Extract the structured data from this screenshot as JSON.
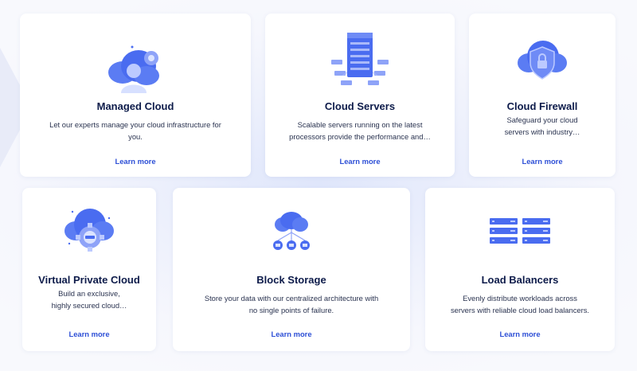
{
  "cards": [
    {
      "title": "Managed Cloud",
      "desc_line1": "Let our experts manage your cloud infrastructure for",
      "desc_line2": "you.",
      "link": "Learn more",
      "icon": "cloud-user-icon"
    },
    {
      "title": "Cloud Servers",
      "desc_line1": "Scalable servers running on the latest",
      "desc_line2": "processors provide the performance and…",
      "link": "Learn more",
      "icon": "server-rack-icon"
    },
    {
      "title": "Cloud Firewall",
      "desc_line1": "Safeguard your cloud",
      "desc_line2": "servers with industry…",
      "link": "Learn more",
      "icon": "cloud-lock-icon"
    },
    {
      "title": "Virtual Private Cloud",
      "desc_line1": "Build an exclusive,",
      "desc_line2": "highly secured cloud…",
      "link": "Learn more",
      "icon": "cloud-gear-icon"
    },
    {
      "title": "Block Storage",
      "desc_line1": "Store your data with our centralized architecture with",
      "desc_line2": "no single points of failure.",
      "link": "Learn more",
      "icon": "cloud-storage-icon"
    },
    {
      "title": "Load Balancers",
      "desc_line1": "Evenly distribute workloads across",
      "desc_line2": "servers with reliable cloud load balancers.",
      "link": "Learn more",
      "icon": "load-balancer-icon"
    }
  ],
  "colors": {
    "accent": "#2d4fd6",
    "title": "#0d1b4a",
    "icon_primary": "#4a6cf0",
    "icon_light": "#a9b9fa"
  }
}
